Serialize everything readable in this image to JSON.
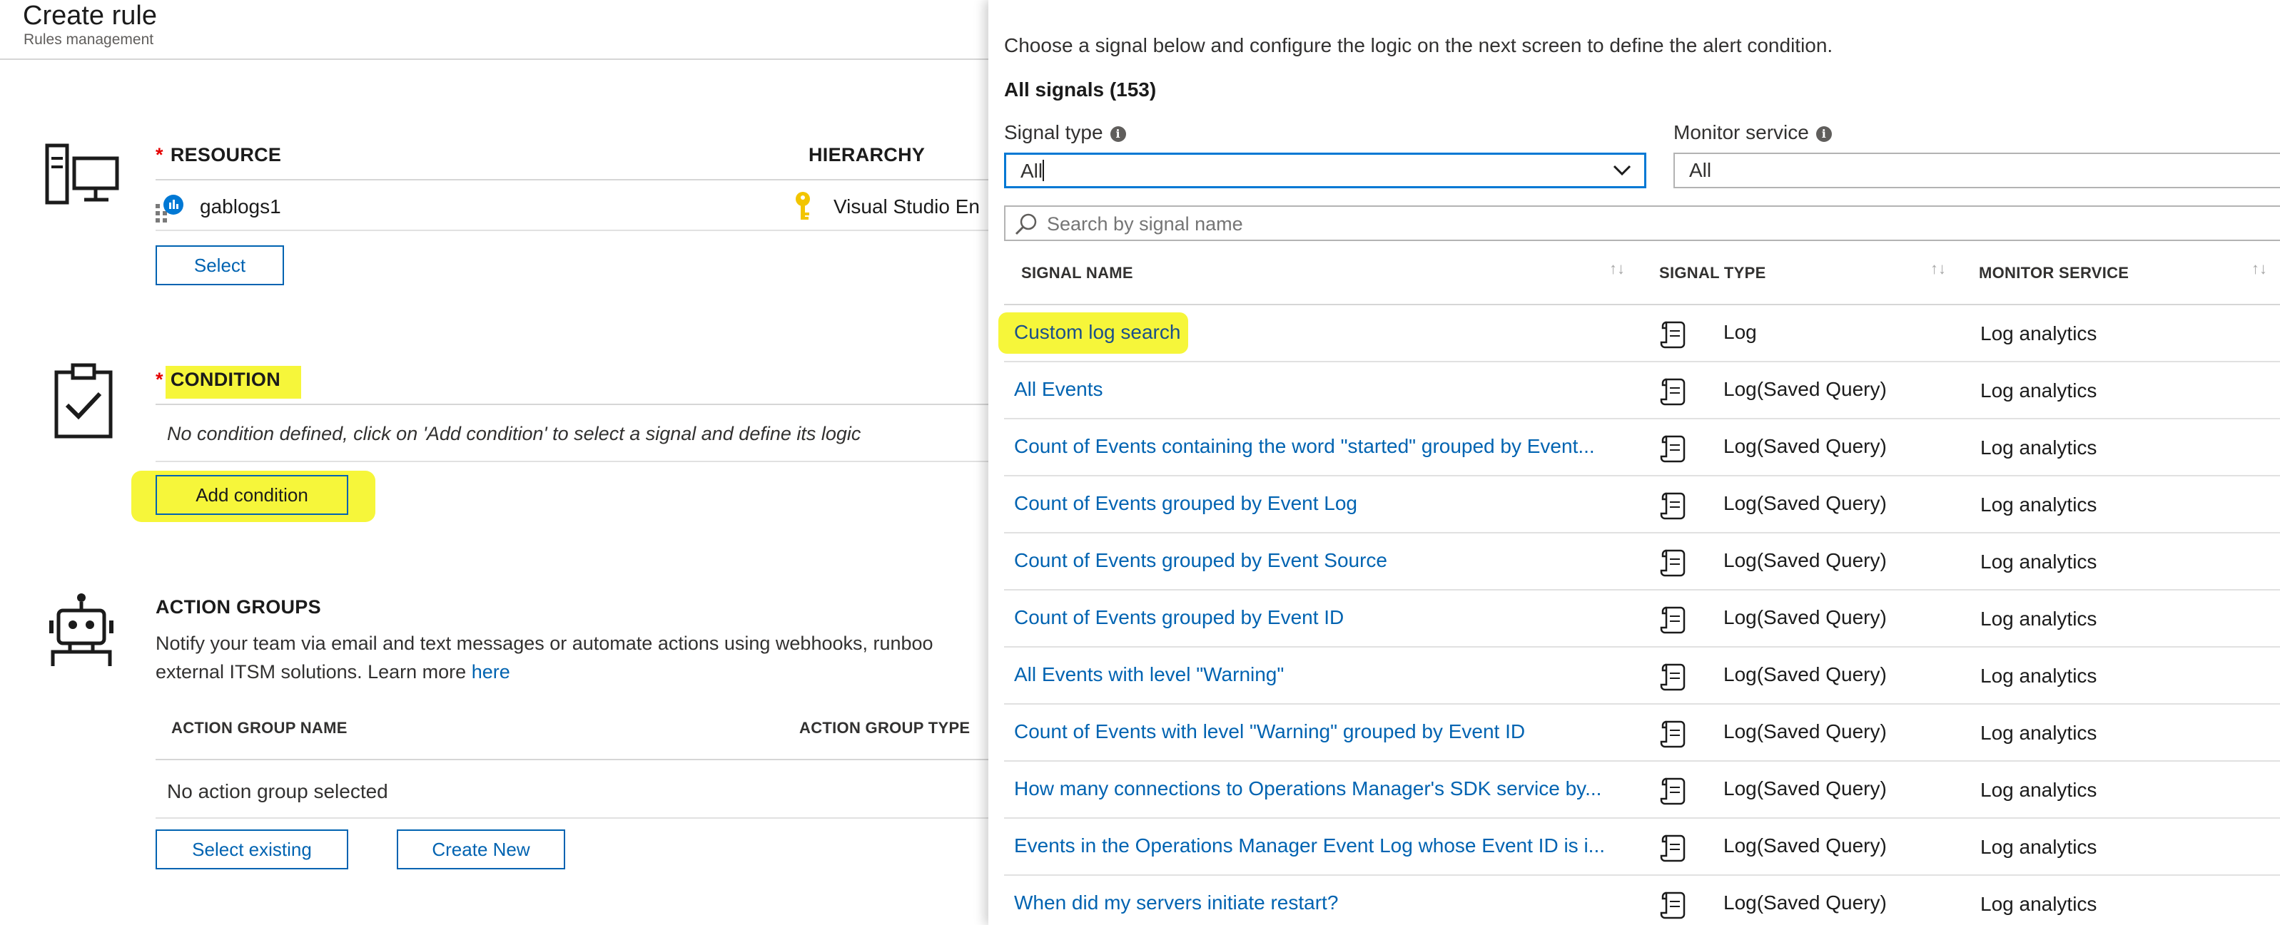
{
  "page": {
    "title": "Create rule",
    "subtitle": "Rules management"
  },
  "resource": {
    "header": "RESOURCE",
    "hierarchy_header": "HIERARCHY",
    "name": "gablogs1",
    "hierarchy_value": "Visual Studio En",
    "select_label": "Select"
  },
  "condition": {
    "header": "CONDITION",
    "empty_text": "No condition defined, click on 'Add condition' to select a signal and define its logic",
    "add_label": "Add condition"
  },
  "action_groups": {
    "header": "ACTION GROUPS",
    "description_line1": "Notify your team via email and text messages or automate actions using webhooks, runboo",
    "description_line2": "external ITSM solutions. Learn more ",
    "learn_more_link": "here",
    "col_name": "ACTION GROUP NAME",
    "col_type": "ACTION GROUP TYPE",
    "empty_text": "No action group selected",
    "select_existing_label": "Select existing",
    "create_new_label": "Create New"
  },
  "signals_panel": {
    "intro": "Choose a signal below and configure the logic on the next screen to define the alert condition.",
    "count_label": "All signals (153)",
    "signal_type_label": "Signal type",
    "signal_type_value": "All",
    "monitor_service_label": "Monitor service",
    "monitor_service_value": "All",
    "search_placeholder": "Search by signal name",
    "columns": {
      "name": "SIGNAL NAME",
      "type": "SIGNAL TYPE",
      "service": "MONITOR SERVICE"
    },
    "rows": [
      {
        "name": "Custom log search",
        "type": "Log",
        "service": "Log analytics"
      },
      {
        "name": "All Events",
        "type": "Log(Saved Query)",
        "service": "Log analytics"
      },
      {
        "name": "Count of Events containing the word \"started\" grouped by Event...",
        "type": "Log(Saved Query)",
        "service": "Log analytics"
      },
      {
        "name": "Count of Events grouped by Event Log",
        "type": "Log(Saved Query)",
        "service": "Log analytics"
      },
      {
        "name": "Count of Events grouped by Event Source",
        "type": "Log(Saved Query)",
        "service": "Log analytics"
      },
      {
        "name": "Count of Events grouped by Event ID",
        "type": "Log(Saved Query)",
        "service": "Log analytics"
      },
      {
        "name": "All Events with level \"Warning\"",
        "type": "Log(Saved Query)",
        "service": "Log analytics"
      },
      {
        "name": "Count of Events with level \"Warning\" grouped by Event ID",
        "type": "Log(Saved Query)",
        "service": "Log analytics"
      },
      {
        "name": "How many connections to Operations Manager's SDK service by...",
        "type": "Log(Saved Query)",
        "service": "Log analytics"
      },
      {
        "name": "Events in the Operations Manager Event Log whose Event ID is i...",
        "type": "Log(Saved Query)",
        "service": "Log analytics"
      },
      {
        "name": "When did my servers initiate restart?",
        "type": "Log(Saved Query)",
        "service": "Log analytics"
      }
    ]
  },
  "colors": {
    "accent": "#0063b1",
    "required": "#e50000",
    "highlight": "#f6f63a",
    "focus_border": "#0078d4"
  }
}
